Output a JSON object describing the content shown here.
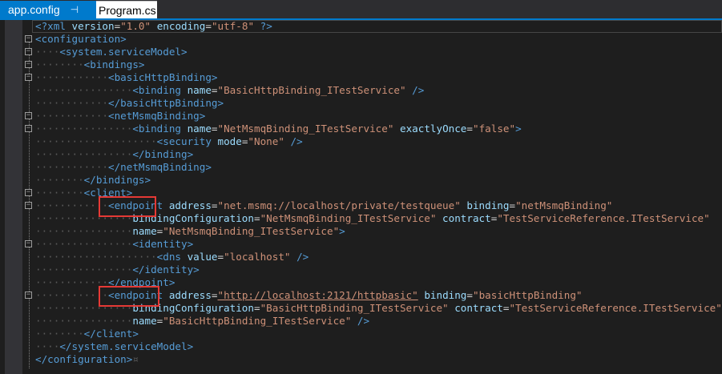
{
  "tabs": [
    {
      "label": "app.config",
      "pin_icon": "pin-icon",
      "active": true
    },
    {
      "label": "Program.cs",
      "active": false
    }
  ],
  "editor": {
    "lines": [
      {
        "indent": "",
        "tokens": [
          [
            "xp",
            "<?xml"
          ],
          [
            "an",
            " version"
          ],
          [
            "eq",
            "="
          ],
          [
            "av",
            "\"1.0\""
          ],
          [
            "an",
            " encoding"
          ],
          [
            "eq",
            "="
          ],
          [
            "av",
            "\"utf-8\""
          ],
          [
            "xp",
            " ?>"
          ]
        ]
      },
      {
        "indent": "",
        "tokens": [
          [
            "tg",
            "<configuration>"
          ]
        ]
      },
      {
        "indent": "····",
        "tokens": [
          [
            "tg",
            "<system.serviceModel>"
          ]
        ]
      },
      {
        "indent": "········",
        "tokens": [
          [
            "tg",
            "<bindings>"
          ]
        ]
      },
      {
        "indent": "············",
        "tokens": [
          [
            "tg",
            "<basicHttpBinding>"
          ]
        ]
      },
      {
        "indent": "················",
        "tokens": [
          [
            "tg",
            "<binding"
          ],
          [
            "an",
            " name"
          ],
          [
            "eq",
            "="
          ],
          [
            "av",
            "\"BasicHttpBinding_ITestService\""
          ],
          [
            "tg",
            " />"
          ]
        ]
      },
      {
        "indent": "············",
        "tokens": [
          [
            "tg",
            "</basicHttpBinding>"
          ]
        ]
      },
      {
        "indent": "············",
        "tokens": [
          [
            "tg",
            "<netMsmqBinding>"
          ]
        ]
      },
      {
        "indent": "················",
        "tokens": [
          [
            "tg",
            "<binding"
          ],
          [
            "an",
            " name"
          ],
          [
            "eq",
            "="
          ],
          [
            "av",
            "\"NetMsmqBinding_ITestService\""
          ],
          [
            "an",
            " exactlyOnce"
          ],
          [
            "eq",
            "="
          ],
          [
            "av",
            "\"false\""
          ],
          [
            "tg",
            ">"
          ]
        ]
      },
      {
        "indent": "····················",
        "tokens": [
          [
            "tg",
            "<security"
          ],
          [
            "an",
            " mode"
          ],
          [
            "eq",
            "="
          ],
          [
            "av",
            "\"None\""
          ],
          [
            "tg",
            " />"
          ]
        ]
      },
      {
        "indent": "················",
        "tokens": [
          [
            "tg",
            "</binding>"
          ]
        ]
      },
      {
        "indent": "············",
        "tokens": [
          [
            "tg",
            "</netMsmqBinding>"
          ]
        ]
      },
      {
        "indent": "········",
        "tokens": [
          [
            "tg",
            "</bindings>"
          ]
        ]
      },
      {
        "indent": "········",
        "tokens": [
          [
            "tg",
            "<client>"
          ]
        ]
      },
      {
        "indent": "············",
        "tokens": [
          [
            "tg",
            "<endpoint"
          ],
          [
            "an",
            " address"
          ],
          [
            "eq",
            "="
          ],
          [
            "av",
            "\"net.msmq://localhost/private/testqueue\""
          ],
          [
            "an",
            " binding"
          ],
          [
            "eq",
            "="
          ],
          [
            "av",
            "\"netMsmqBinding\""
          ]
        ]
      },
      {
        "indent": "················",
        "tokens": [
          [
            "an",
            "bindingConfiguration"
          ],
          [
            "eq",
            "="
          ],
          [
            "av",
            "\"NetMsmqBinding_ITestService\""
          ],
          [
            "an",
            " contract"
          ],
          [
            "eq",
            "="
          ],
          [
            "av",
            "\"TestServiceReference.ITestService\""
          ]
        ]
      },
      {
        "indent": "················",
        "tokens": [
          [
            "an",
            "name"
          ],
          [
            "eq",
            "="
          ],
          [
            "av",
            "\"NetMsmqBinding_ITestService\""
          ],
          [
            "tg",
            ">"
          ]
        ]
      },
      {
        "indent": "················",
        "tokens": [
          [
            "tg",
            "<identity>"
          ]
        ]
      },
      {
        "indent": "····················",
        "tokens": [
          [
            "tg",
            "<dns"
          ],
          [
            "an",
            " value"
          ],
          [
            "eq",
            "="
          ],
          [
            "av",
            "\"localhost\""
          ],
          [
            "tg",
            " />"
          ]
        ]
      },
      {
        "indent": "················",
        "tokens": [
          [
            "tg",
            "</identity>"
          ]
        ]
      },
      {
        "indent": "············",
        "tokens": [
          [
            "tg",
            "</endpoint>"
          ]
        ]
      },
      {
        "indent": "············",
        "tokens": [
          [
            "tg",
            "<endpoint"
          ],
          [
            "an",
            " address"
          ],
          [
            "eq",
            "="
          ],
          [
            "avu",
            "\"http://localhost:2121/httpbasic\""
          ],
          [
            "an",
            " binding"
          ],
          [
            "eq",
            "="
          ],
          [
            "av",
            "\"basicHttpBinding\""
          ]
        ]
      },
      {
        "indent": "················",
        "tokens": [
          [
            "an",
            "bindingConfiguration"
          ],
          [
            "eq",
            "="
          ],
          [
            "av",
            "\"BasicHttpBinding_ITestService\""
          ],
          [
            "an",
            " contract"
          ],
          [
            "eq",
            "="
          ],
          [
            "av",
            "\"TestServiceReference.ITestService\""
          ]
        ]
      },
      {
        "indent": "················",
        "tokens": [
          [
            "an",
            "name"
          ],
          [
            "eq",
            "="
          ],
          [
            "av",
            "\"BasicHttpBinding_ITestService\""
          ],
          [
            "tg",
            " />"
          ]
        ]
      },
      {
        "indent": "········",
        "tokens": [
          [
            "tg",
            "</client>"
          ]
        ]
      },
      {
        "indent": "····",
        "tokens": [
          [
            "tg",
            "</system.serviceModel>"
          ]
        ]
      },
      {
        "indent": "",
        "tokens": [
          [
            "tg",
            "</configuration>"
          ],
          [
            "dots",
            "¤"
          ]
        ]
      }
    ],
    "fold_markers": [
      1,
      2,
      3,
      4,
      7,
      8,
      13,
      14,
      17,
      21
    ]
  },
  "colors": {
    "tab_active": "#007acc",
    "highlight_box": "#e53935",
    "tag": "#569cd6",
    "attr_name": "#9cdcfe",
    "attr_value": "#ce9178"
  }
}
